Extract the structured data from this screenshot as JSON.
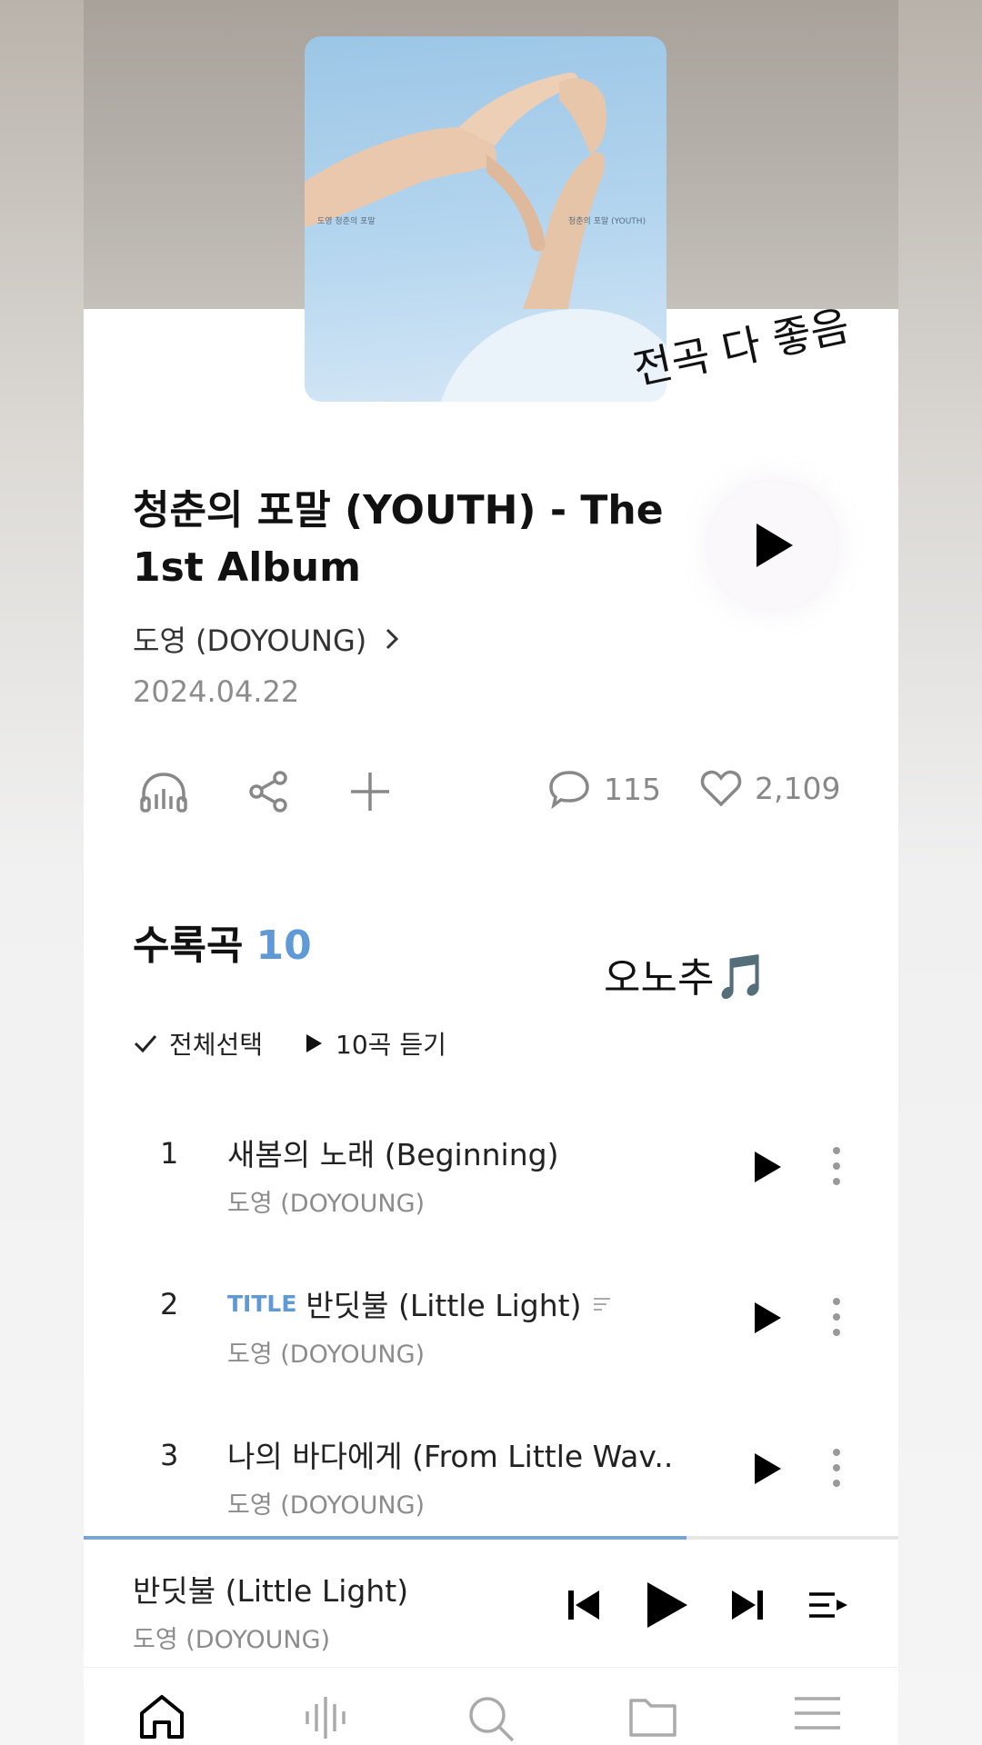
{
  "album": {
    "title": "청춘의 포말 (YOUTH) - The 1st Album",
    "artist": "도영 (DOYOUNG)",
    "release_date": "2024.04.22",
    "cover": {
      "left_text": "도영   청춘의 포말",
      "right_text": "청춘의 포말 (YOUTH)"
    }
  },
  "annotations": {
    "all_tracks": "전곡 다 좋음",
    "ono": "오노추",
    "note_emoji": "🎵"
  },
  "actions": {
    "comments": "115",
    "likes": "2,109"
  },
  "tracklist": {
    "heading": "수록곡",
    "count": "10",
    "select_all": "전체선택",
    "play_all": "10곡 듣기",
    "tracks": [
      {
        "num": "1",
        "title": "새봄의 노래 (Beginning)",
        "tag": "",
        "artist": "도영 (DOYOUNG)"
      },
      {
        "num": "2",
        "title": "반딧불 (Little Light)",
        "tag": "TITLE",
        "artist": "도영 (DOYOUNG)"
      },
      {
        "num": "3",
        "title": "나의 바다에게 (From Little Wav..",
        "tag": "",
        "artist": "도영 (DOYOUNG)"
      }
    ]
  },
  "player": {
    "title": "반딧불 (Little Light)",
    "artist": "도영 (DOYOUNG)",
    "progress": 0.74
  },
  "nav": [
    "home-icon",
    "equalizer-icon",
    "search-icon",
    "folder-icon",
    "menu-icon"
  ],
  "colors": {
    "accent": "#5f9ad6",
    "progress": "#7aa5d3"
  }
}
